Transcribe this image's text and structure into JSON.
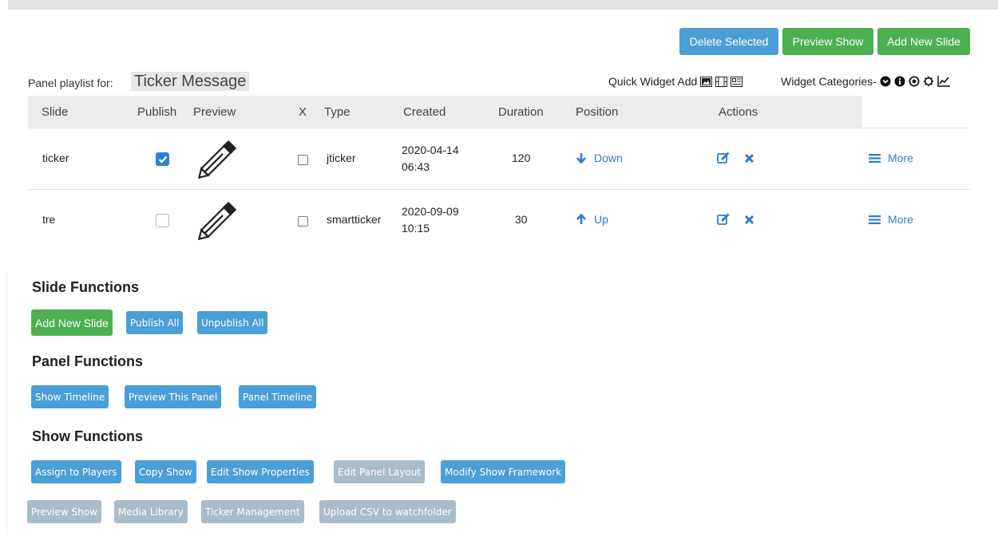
{
  "top_actions": {
    "delete_selected": "Delete Selected",
    "preview_show": "Preview Show",
    "add_new_slide": "Add New Slide"
  },
  "panel": {
    "label": "Panel playlist for:",
    "name": "Ticker Message"
  },
  "quick_widget_add": {
    "label": "Quick Widget Add",
    "icons": [
      "image-icon",
      "film-icon",
      "newspaper-icon"
    ]
  },
  "widget_categories": {
    "label": "Widget Categories-",
    "icons": [
      "chevron-circle-icon",
      "info-circle-icon",
      "dot-circle-icon",
      "gear-icon",
      "line-chart-icon"
    ]
  },
  "table": {
    "headers": {
      "slide": "Slide",
      "publish": "Publish",
      "preview": "Preview",
      "x": "X",
      "type": "Type",
      "created": "Created",
      "duration": "Duration",
      "position": "Position",
      "actions": "Actions"
    },
    "rows": [
      {
        "slide": "ticker",
        "published": true,
        "type": "jticker",
        "created_date": "2020-04-14",
        "created_time": "06:43",
        "duration": "120",
        "position_label": "Down",
        "more_label": "More"
      },
      {
        "slide": "tre",
        "published": false,
        "type": "smartticker",
        "created_date": "2020-09-09",
        "created_time": "10:15",
        "duration": "30",
        "position_label": "Up",
        "more_label": "More"
      }
    ]
  },
  "slide_functions": {
    "title": "Slide Functions",
    "add_new_slide": "Add New Slide",
    "publish_all": "Publish All",
    "unpublish_all": "Unpublish All"
  },
  "panel_functions": {
    "title": "Panel Functions",
    "show_timeline": "Show Timeline",
    "preview_this_panel": "Preview This Panel",
    "panel_timeline": "Panel Timeline"
  },
  "show_functions": {
    "title": "Show Functions",
    "assign_to_players": "Assign to Players",
    "copy_show": "Copy Show",
    "edit_show_properties": "Edit Show Properties",
    "edit_panel_layout": "Edit Panel Layout",
    "modify_show_framework": "Modify Show Framework",
    "preview_show": "Preview Show",
    "media_library": "Media Library",
    "ticker_management": "Ticker Management",
    "upload_csv": "Upload CSV to watchfolder"
  },
  "colors": {
    "blue": "#4a9fd6",
    "green": "#4cb051",
    "disabled": "#a8bcc9",
    "link": "#2e7ccc"
  }
}
